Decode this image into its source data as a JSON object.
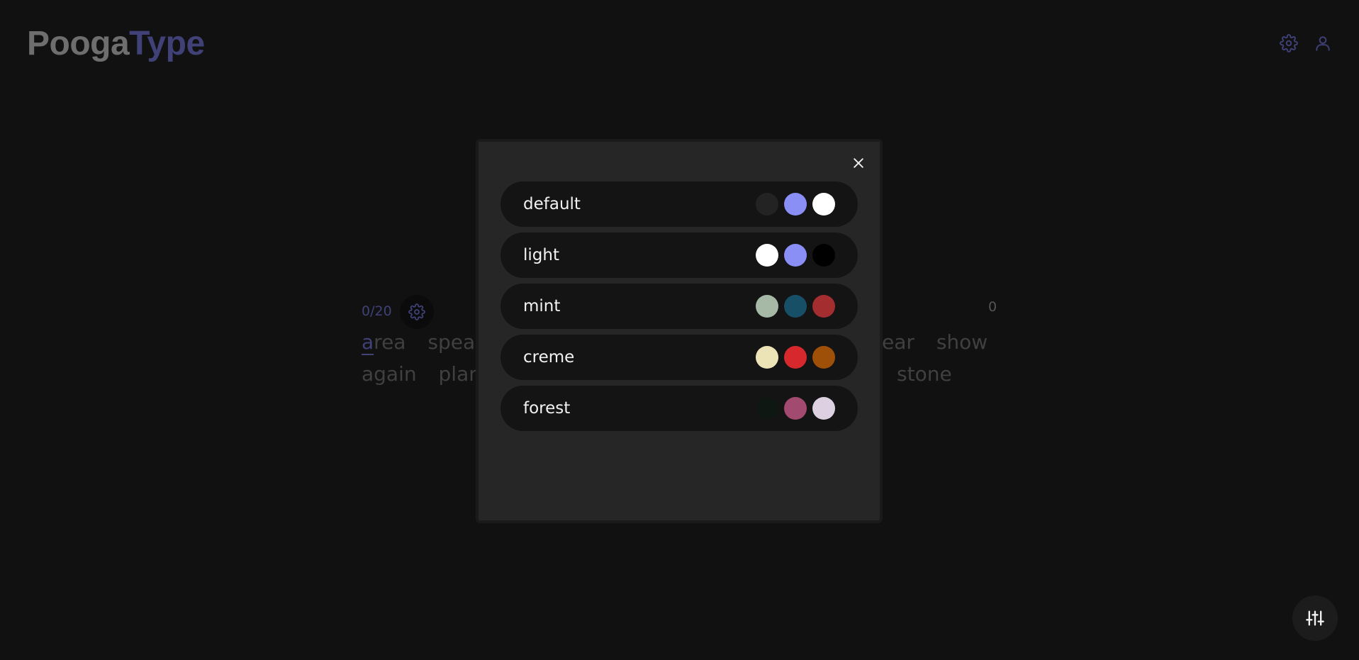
{
  "logo": {
    "part1": "Pooga",
    "part2": "Type"
  },
  "header_icons": [
    "settings-gear-icon",
    "user-icon"
  ],
  "test": {
    "counter": "0/20",
    "wpm": "0",
    "line1": {
      "first_letter": "a",
      "first_rest": "rea",
      "words_before": [
        "speak"
      ],
      "words_after": [
        "ear",
        "show"
      ]
    },
    "line2": {
      "words_before": [
        "again",
        "plane"
      ],
      "words_after": [
        "stone"
      ]
    }
  },
  "theme_modal": {
    "close_icon": "close-icon",
    "themes": [
      {
        "name": "default",
        "colors": [
          "#232323",
          "#8a8ff5",
          "#ffffff"
        ]
      },
      {
        "name": "light",
        "colors": [
          "#ffffff",
          "#8a8ff5",
          "#000000"
        ]
      },
      {
        "name": "mint",
        "colors": [
          "#a5b9a6",
          "#174f67",
          "#a42d30"
        ]
      },
      {
        "name": "creme",
        "colors": [
          "#ece3b7",
          "#d7282e",
          "#9e5009"
        ]
      },
      {
        "name": "forest",
        "colors": [
          "#0f1712",
          "#a24a70",
          "#ddd0e1"
        ]
      }
    ]
  },
  "colors": {
    "background": "#111111",
    "accent": "#3f4177",
    "modal_bg": "#262626",
    "row_bg": "#141414"
  }
}
